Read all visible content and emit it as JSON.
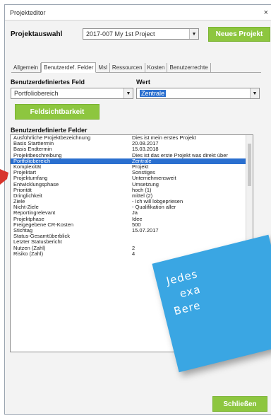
{
  "window": {
    "title": "Projekteditor",
    "close_glyph": "×"
  },
  "project_select": {
    "label": "Projektauswahl",
    "value": "2017-007  My 1st Project",
    "new_button": "Neues Projekt"
  },
  "tabs": [
    {
      "label": "Allgemein",
      "active": false
    },
    {
      "label": "Benutzerdef. Felder",
      "active": true
    },
    {
      "label": "Msl",
      "active": false
    },
    {
      "label": "Ressourcen",
      "active": false
    },
    {
      "label": "Kosten",
      "active": false
    },
    {
      "label": "Benutzerrechte",
      "active": false
    }
  ],
  "field_editor": {
    "field_header": "Benutzerdefiniertes Feld",
    "value_header": "Wert",
    "field_value": "Portfoliobereich",
    "value_value": "Zentrale",
    "visibility_button": "Feldsichtbarkeit"
  },
  "fields_list": {
    "header": "Benutzerdefinierte Felder",
    "rows": [
      {
        "name": "Ausführliche Projektbezeichnung",
        "value": "Dies ist mein erstes Projekt",
        "selected": false
      },
      {
        "name": "Basis Starttermin",
        "value": "20.08.2017",
        "selected": false
      },
      {
        "name": "Basis Endtermin",
        "value": "15.03.2018",
        "selected": false
      },
      {
        "name": "Projektbeschreibung",
        "value": "Dies ist das erste Projekt was direkt über",
        "selected": false
      },
      {
        "name": "Portfoliobereich",
        "value": "Zentrale",
        "selected": true
      },
      {
        "name": "Komplexität",
        "value": "Projekt",
        "selected": false
      },
      {
        "name": "Projektart",
        "value": "Sonstiges",
        "selected": false
      },
      {
        "name": "Projektumfang",
        "value": "Unternehmensweit",
        "selected": false
      },
      {
        "name": "Entwicklungsphase",
        "value": "Umsetzung",
        "selected": false
      },
      {
        "name": "Priorität",
        "value": "hoch (1)",
        "selected": false
      },
      {
        "name": "Dringlichkeit",
        "value": "mittel (2)",
        "selected": false
      },
      {
        "name": "Ziele",
        "value": "- Ich will lobgepriesen",
        "selected": false
      },
      {
        "name": "Nicht-Ziele",
        "value": "- Qualifikation aller",
        "selected": false
      },
      {
        "name": "Reportingrelevant",
        "value": "Ja",
        "selected": false
      },
      {
        "name": "Projektphase",
        "value": "Idee",
        "selected": false
      },
      {
        "name": "Freigegebene CR-Kosten",
        "value": "500",
        "selected": false
      },
      {
        "name": "Stichtag",
        "value": "15.07.2017",
        "selected": false
      },
      {
        "name": "Status-Gesamtüberblick",
        "value": "",
        "selected": false
      },
      {
        "name": "Letzter Statusbericht",
        "value": "",
        "selected": false
      },
      {
        "name": "Nutzen (Zahl)",
        "value": "2",
        "selected": false
      },
      {
        "name": "Risiko (Zahl)",
        "value": "4",
        "selected": false
      }
    ]
  },
  "footer": {
    "close_button": "Schließen"
  },
  "sticky_note": {
    "lines": [
      "Jedes",
      "exa",
      "Bere"
    ]
  },
  "colors": {
    "accent_green": "#8dc63f",
    "selection_blue": "#2a6fcf",
    "sticky_blue": "#3aa6e3",
    "red_mark": "#d8342c"
  },
  "icons": {
    "combo_arrow": "chevron-down-icon",
    "close": "close-icon"
  }
}
